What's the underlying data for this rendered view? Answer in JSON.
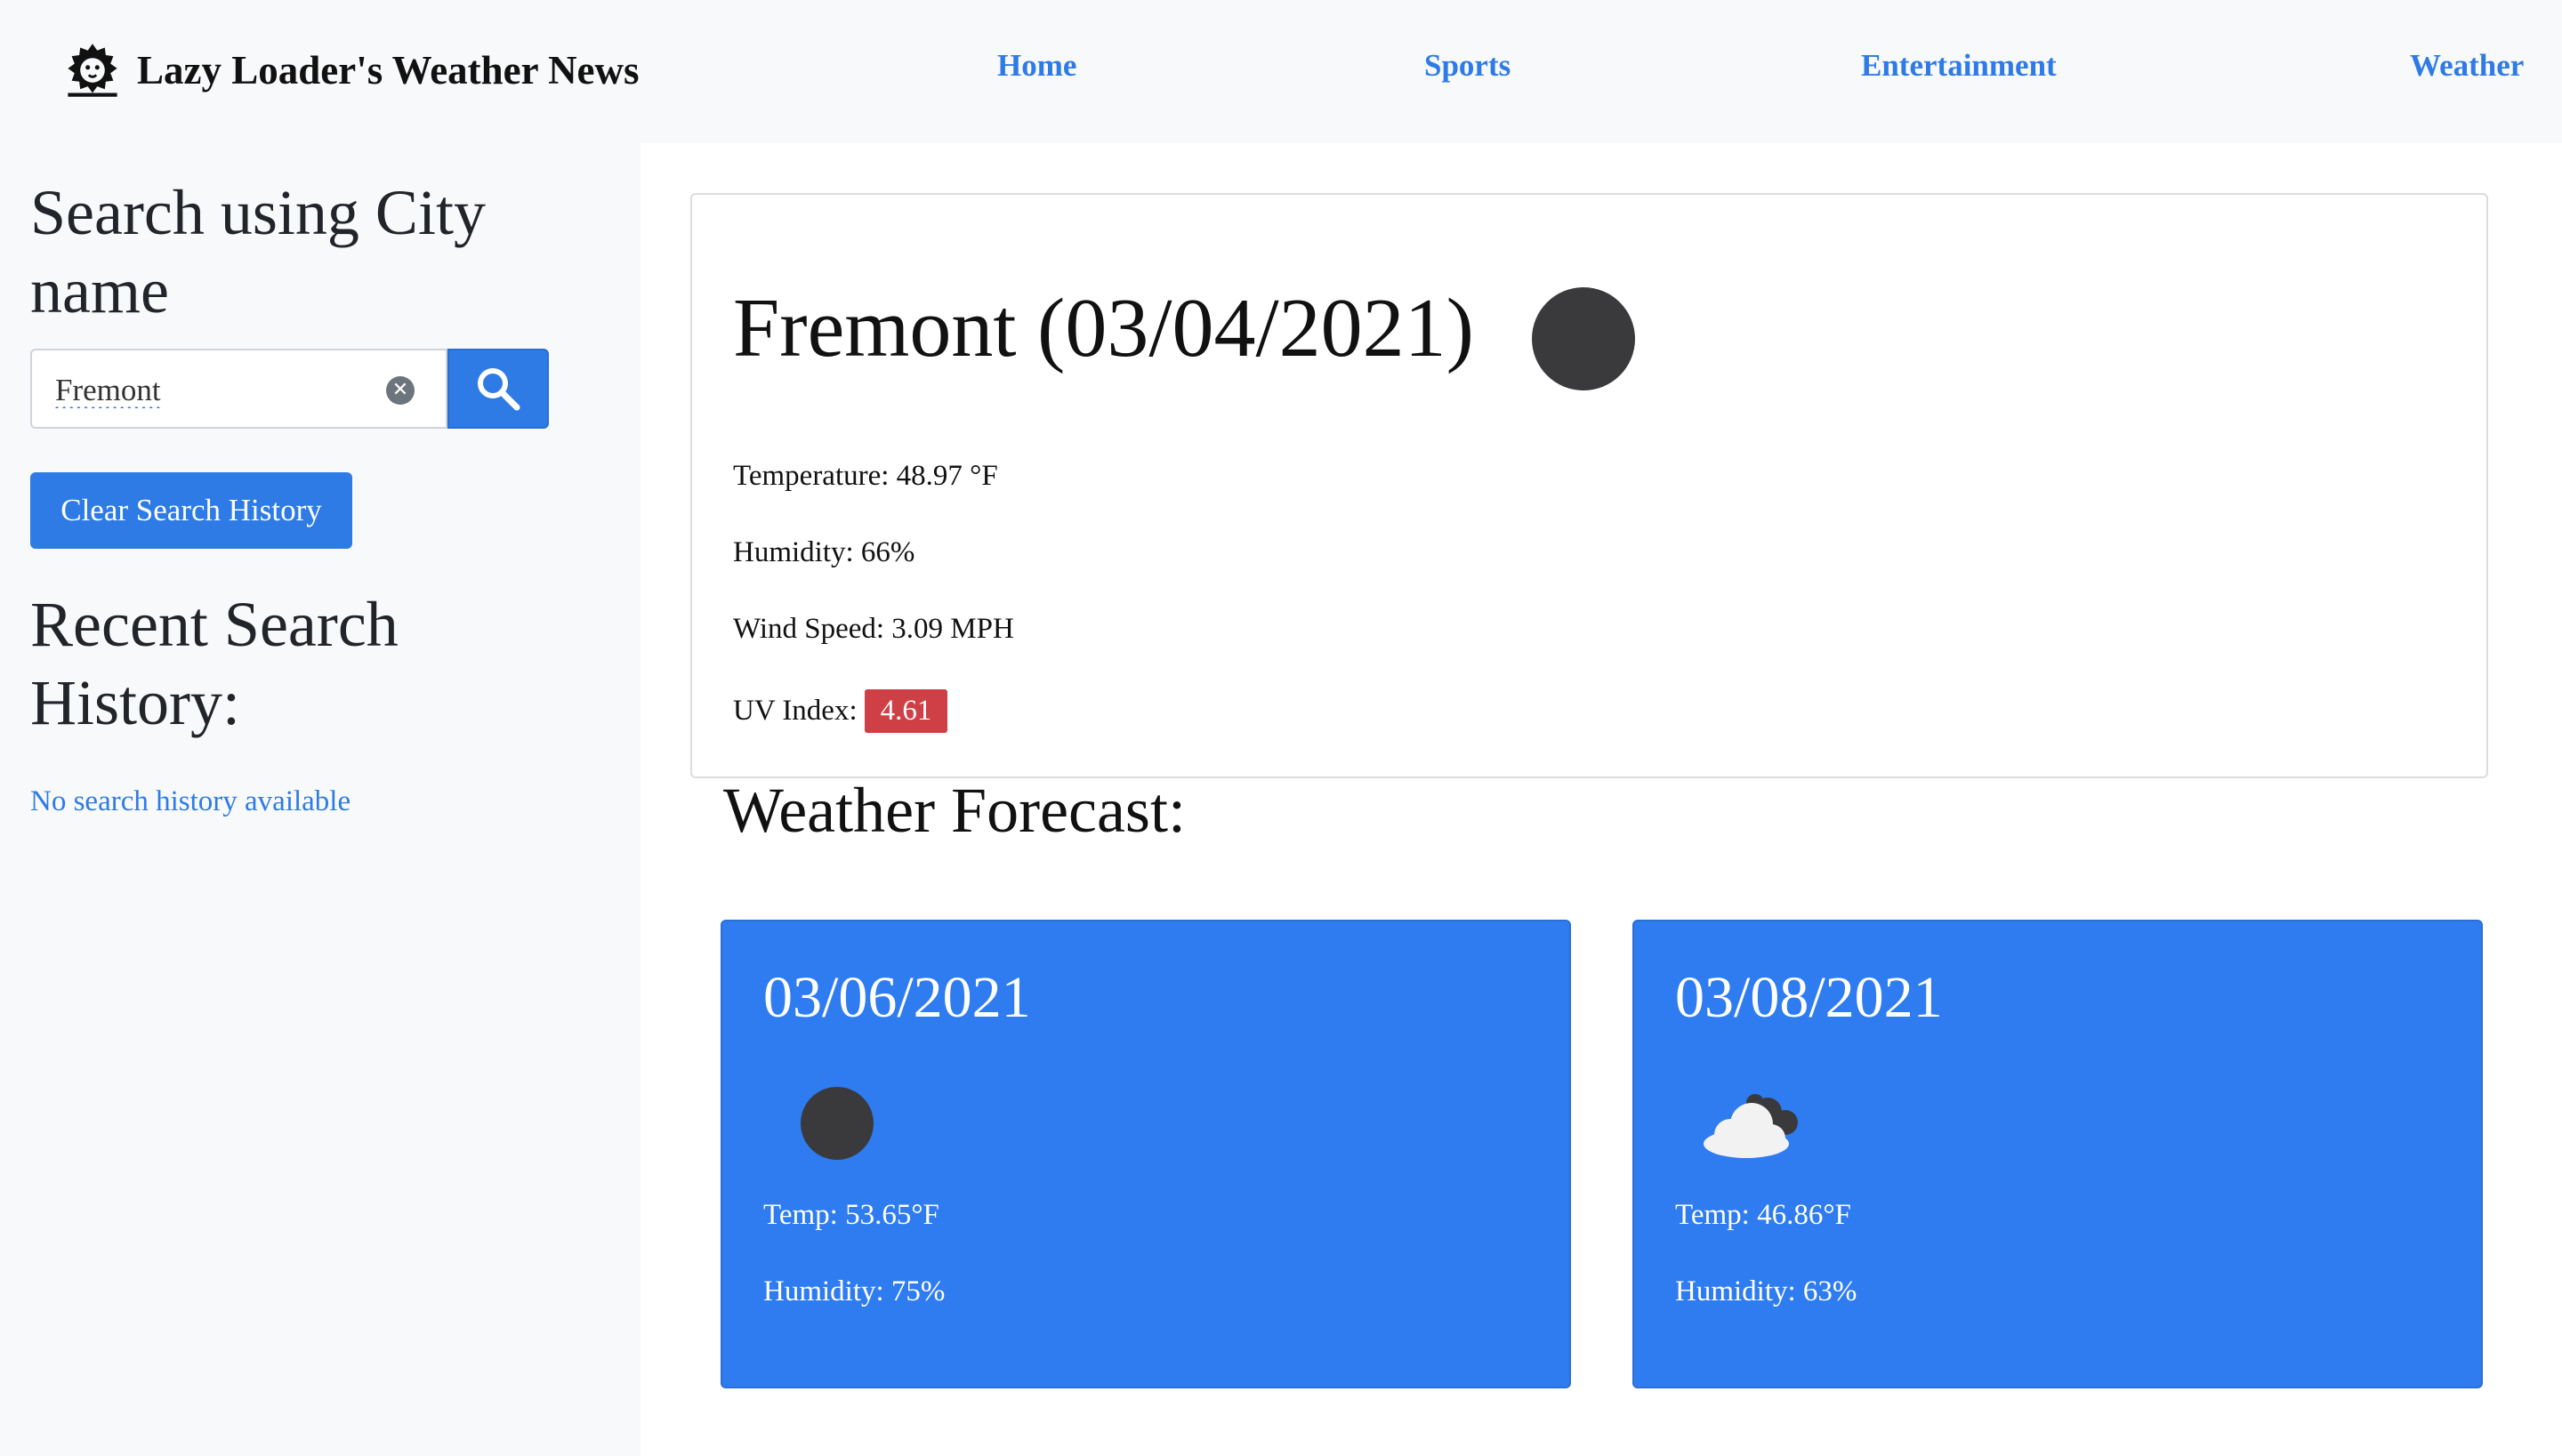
{
  "brand": {
    "title": "Lazy Loader's Weather News",
    "logo_icon": "lion-head-icon"
  },
  "nav": {
    "items": [
      {
        "label": "Home"
      },
      {
        "label": "Sports"
      },
      {
        "label": "Entertainment"
      },
      {
        "label": "Weather"
      }
    ]
  },
  "sidebar": {
    "search_heading": "Search using City name",
    "search_value": "Fremont",
    "clear_history_label": "Clear Search History",
    "recent_heading": "Recent Search History:",
    "no_history_text": "No search history available"
  },
  "current": {
    "title": "Fremont (03/04/2021)",
    "icon": "moon-icon",
    "temperature": "Temperature: 48.97 °F",
    "humidity": "Humidity: 66%",
    "wind": "Wind Speed: 3.09 MPH",
    "uv_label": "UV Index:",
    "uv_value": "4.61",
    "uv_color": "#cf3f46"
  },
  "forecast": {
    "title": "Weather Forecast:",
    "days": [
      {
        "date": "03/06/2021",
        "icon": "moon-icon",
        "temp": "Temp: 53.65°F",
        "humidity": "Humidity: 75%"
      },
      {
        "date": "03/08/2021",
        "icon": "cloud-night-icon",
        "temp": "Temp: 46.86°F",
        "humidity": "Humidity: 63%"
      }
    ]
  },
  "colors": {
    "accent": "#2e7be6",
    "card_blue": "#2f7cf0",
    "sidebar_bg": "#f8f9fa"
  }
}
